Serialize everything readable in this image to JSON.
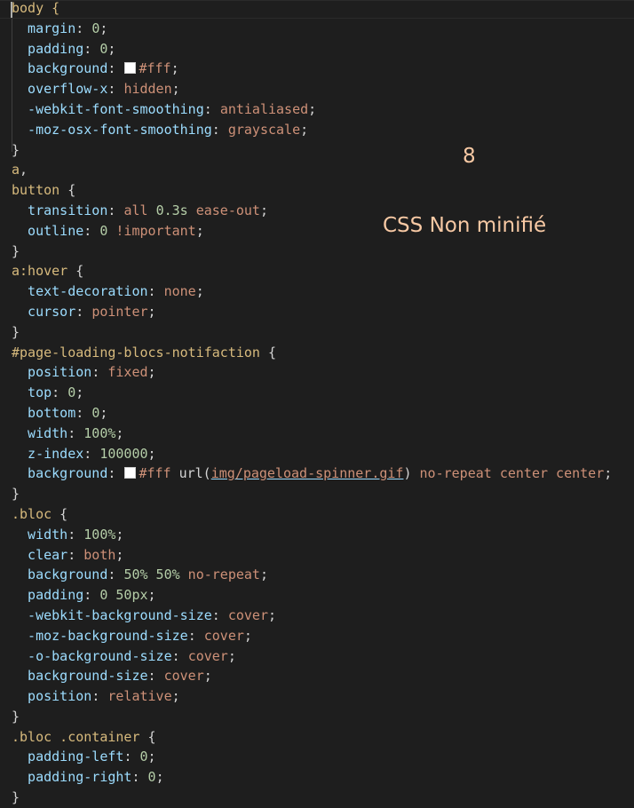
{
  "annotation": {
    "number": "8",
    "label": "CSS Non minifié"
  },
  "colors": {
    "background": "#1e1e1e",
    "selector": "#d7ba7d",
    "property": "#9cdcfe",
    "value": "#ce9178",
    "number": "#b5cea8",
    "annotation": "#f8c9a4"
  },
  "lines": [
    [
      [
        "body {",
        "sel"
      ]
    ],
    [
      [
        "  margin",
        "prop"
      ],
      [
        ": ",
        "pun"
      ],
      [
        "0",
        "num"
      ],
      [
        ";",
        "pun"
      ]
    ],
    [
      [
        "  padding",
        "prop"
      ],
      [
        ": ",
        "pun"
      ],
      [
        "0",
        "num"
      ],
      [
        ";",
        "pun"
      ]
    ],
    [
      [
        "  background",
        "prop"
      ],
      [
        ": ",
        "pun"
      ],
      [
        "",
        "sw"
      ],
      [
        "#fff",
        "val"
      ],
      [
        ";",
        "pun"
      ]
    ],
    [
      [
        "  overflow-x",
        "prop"
      ],
      [
        ": ",
        "pun"
      ],
      [
        "hidden",
        "val"
      ],
      [
        ";",
        "pun"
      ]
    ],
    [
      [
        "  -webkit-font-smoothing",
        "prop"
      ],
      [
        ": ",
        "pun"
      ],
      [
        "antialiased",
        "val"
      ],
      [
        ";",
        "pun"
      ]
    ],
    [
      [
        "  -moz-osx-font-smoothing",
        "prop"
      ],
      [
        ": ",
        "pun"
      ],
      [
        "grayscale",
        "val"
      ],
      [
        ";",
        "pun"
      ]
    ],
    [
      [
        "}",
        "pun"
      ]
    ],
    [
      [
        "a",
        "sel"
      ],
      [
        ",",
        "pun"
      ]
    ],
    [
      [
        "button",
        "sel"
      ],
      [
        " {",
        "pun"
      ]
    ],
    [
      [
        "  transition",
        "prop"
      ],
      [
        ": ",
        "pun"
      ],
      [
        "all ",
        "val"
      ],
      [
        "0.3s",
        "num"
      ],
      [
        " ease-out",
        "val"
      ],
      [
        ";",
        "pun"
      ]
    ],
    [
      [
        "  outline",
        "prop"
      ],
      [
        ": ",
        "pun"
      ],
      [
        "0",
        "num"
      ],
      [
        " !important",
        "val"
      ],
      [
        ";",
        "pun"
      ]
    ],
    [
      [
        "}",
        "pun"
      ]
    ],
    [
      [
        "a:hover",
        "sel"
      ],
      [
        " {",
        "pun"
      ]
    ],
    [
      [
        "  text-decoration",
        "prop"
      ],
      [
        ": ",
        "pun"
      ],
      [
        "none",
        "val"
      ],
      [
        ";",
        "pun"
      ]
    ],
    [
      [
        "  cursor",
        "prop"
      ],
      [
        ": ",
        "pun"
      ],
      [
        "pointer",
        "val"
      ],
      [
        ";",
        "pun"
      ]
    ],
    [
      [
        "}",
        "pun"
      ]
    ],
    [
      [
        "#page-loading-blocs-notifaction",
        "sel"
      ],
      [
        " {",
        "pun"
      ]
    ],
    [
      [
        "  position",
        "prop"
      ],
      [
        ": ",
        "pun"
      ],
      [
        "fixed",
        "val"
      ],
      [
        ";",
        "pun"
      ]
    ],
    [
      [
        "  top",
        "prop"
      ],
      [
        ": ",
        "pun"
      ],
      [
        "0",
        "num"
      ],
      [
        ";",
        "pun"
      ]
    ],
    [
      [
        "  bottom",
        "prop"
      ],
      [
        ": ",
        "pun"
      ],
      [
        "0",
        "num"
      ],
      [
        ";",
        "pun"
      ]
    ],
    [
      [
        "  width",
        "prop"
      ],
      [
        ": ",
        "pun"
      ],
      [
        "100%",
        "num"
      ],
      [
        ";",
        "pun"
      ]
    ],
    [
      [
        "  z-index",
        "prop"
      ],
      [
        ": ",
        "pun"
      ],
      [
        "100000",
        "num"
      ],
      [
        ";",
        "pun"
      ]
    ],
    [
      [
        "  background",
        "prop"
      ],
      [
        ": ",
        "pun"
      ],
      [
        "",
        "sw"
      ],
      [
        "#fff",
        "val"
      ],
      [
        " url(",
        "pun"
      ],
      [
        "img/pageload-spinner.gif",
        "url"
      ],
      [
        ")",
        "pun"
      ],
      [
        " no-repeat center center",
        "val"
      ],
      [
        ";",
        "pun"
      ]
    ],
    [
      [
        "}",
        "pun"
      ]
    ],
    [
      [
        ".bloc",
        "sel"
      ],
      [
        " {",
        "pun"
      ]
    ],
    [
      [
        "  width",
        "prop"
      ],
      [
        ": ",
        "pun"
      ],
      [
        "100%",
        "num"
      ],
      [
        ";",
        "pun"
      ]
    ],
    [
      [
        "  clear",
        "prop"
      ],
      [
        ": ",
        "pun"
      ],
      [
        "both",
        "val"
      ],
      [
        ";",
        "pun"
      ]
    ],
    [
      [
        "  background",
        "prop"
      ],
      [
        ": ",
        "pun"
      ],
      [
        "50% 50%",
        "num"
      ],
      [
        " no-repeat",
        "val"
      ],
      [
        ";",
        "pun"
      ]
    ],
    [
      [
        "  padding",
        "prop"
      ],
      [
        ": ",
        "pun"
      ],
      [
        "0 50px",
        "num"
      ],
      [
        ";",
        "pun"
      ]
    ],
    [
      [
        "  -webkit-background-size",
        "prop"
      ],
      [
        ": ",
        "pun"
      ],
      [
        "cover",
        "val"
      ],
      [
        ";",
        "pun"
      ]
    ],
    [
      [
        "  -moz-background-size",
        "prop"
      ],
      [
        ": ",
        "pun"
      ],
      [
        "cover",
        "val"
      ],
      [
        ";",
        "pun"
      ]
    ],
    [
      [
        "  -o-background-size",
        "prop"
      ],
      [
        ": ",
        "pun"
      ],
      [
        "cover",
        "val"
      ],
      [
        ";",
        "pun"
      ]
    ],
    [
      [
        "  background-size",
        "prop"
      ],
      [
        ": ",
        "pun"
      ],
      [
        "cover",
        "val"
      ],
      [
        ";",
        "pun"
      ]
    ],
    [
      [
        "  position",
        "prop"
      ],
      [
        ": ",
        "pun"
      ],
      [
        "relative",
        "val"
      ],
      [
        ";",
        "pun"
      ]
    ],
    [
      [
        "}",
        "pun"
      ]
    ],
    [
      [
        ".bloc .container",
        "sel"
      ],
      [
        " {",
        "pun"
      ]
    ],
    [
      [
        "  padding-left",
        "prop"
      ],
      [
        ": ",
        "pun"
      ],
      [
        "0",
        "num"
      ],
      [
        ";",
        "pun"
      ]
    ],
    [
      [
        "  padding-right",
        "prop"
      ],
      [
        ": ",
        "pun"
      ],
      [
        "0",
        "num"
      ],
      [
        ";",
        "pun"
      ]
    ],
    [
      [
        "}",
        "pun"
      ]
    ]
  ]
}
